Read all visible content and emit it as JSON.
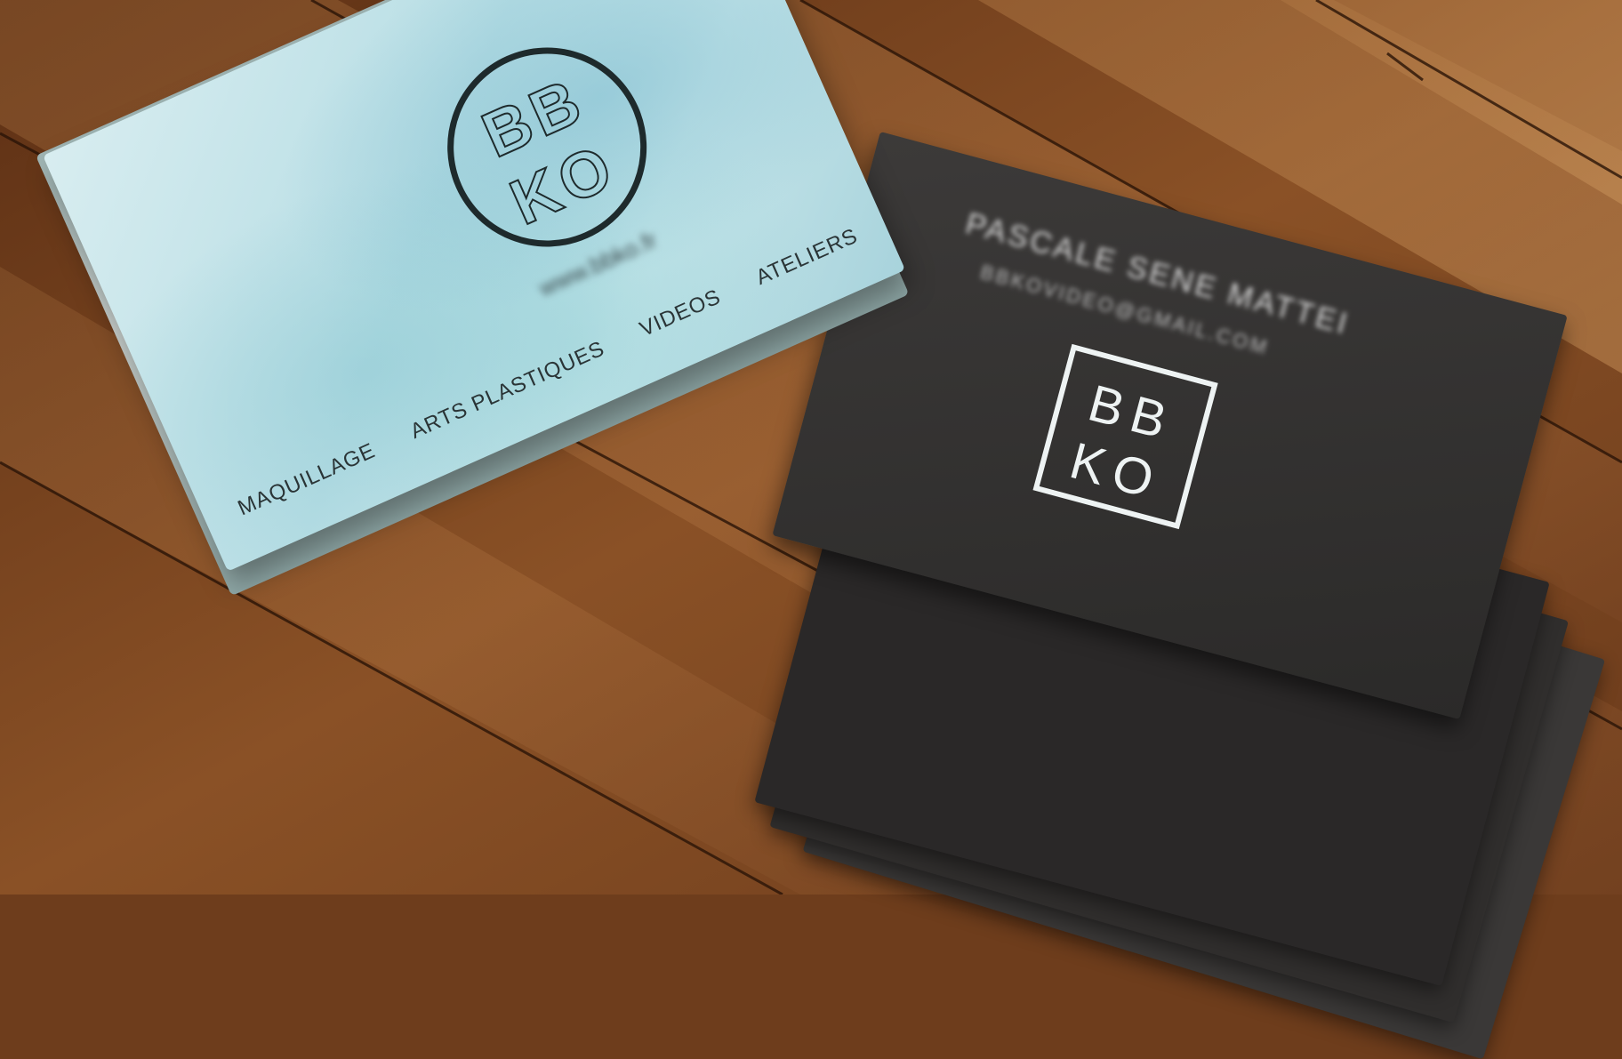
{
  "blue_card": {
    "logo_line1": "BB",
    "logo_line2": "KO",
    "website": "www.bbko.fr",
    "services": [
      "MAQUILLAGE",
      "ARTS PLASTIQUES",
      "VIDEOS",
      "ATELIERS"
    ]
  },
  "dark_card": {
    "name": "PASCALE SENE MATTEI",
    "email": "BBKOVIDEO@GMAIL.COM",
    "logo_line1": "BB",
    "logo_line2": "KO"
  },
  "colors": {
    "wood": "#6e3d1c",
    "blue_card": "#c7e6ea",
    "dark_card": "#2f2d2c",
    "logo_light": "#eef3f3"
  }
}
